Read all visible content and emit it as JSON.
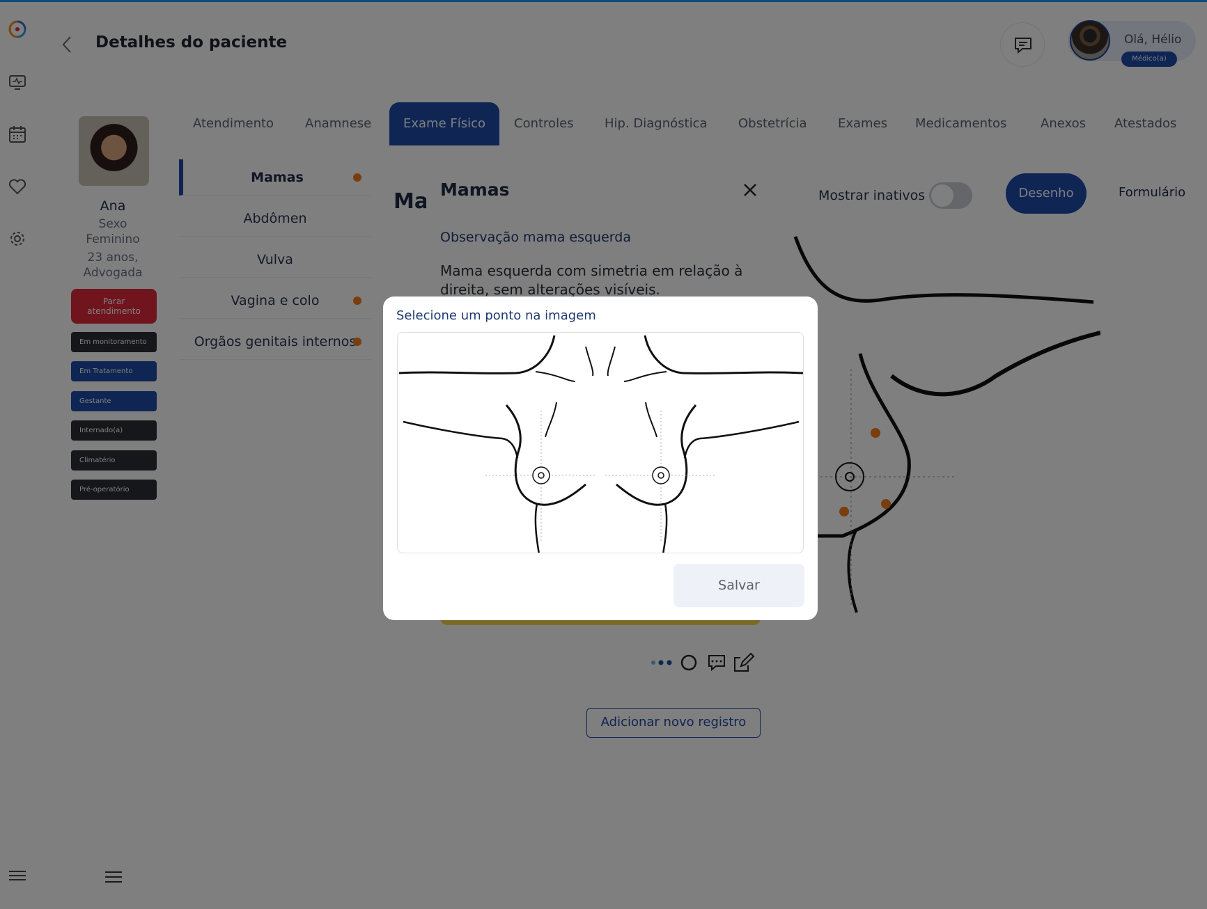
{
  "header": {
    "title": "Detalhes do paciente",
    "greeting": "Olá, Hélio",
    "role": "Médico(a)"
  },
  "patient": {
    "name": "Ana",
    "sex_line1": "Sexo",
    "sex_line2": "Feminino",
    "age_line1": "23 anos,",
    "age_line2": "Advogada",
    "stop_line1": "Parar",
    "stop_line2": "atendimento",
    "tags": [
      "Em monitoramento",
      "Em Tratamento",
      "Gestante",
      "Internado(a)",
      "Climatério",
      "Pré-operatório"
    ]
  },
  "tabs": [
    "Atendimento",
    "Anamnese",
    "Exame Físico",
    "Controles",
    "Hip. Diagnóstica",
    "Obstetrícia",
    "Exames",
    "Medicamentos",
    "Anexos",
    "Atestados"
  ],
  "sections": [
    "Mamas",
    "Abdômen",
    "Vulva",
    "Vagina e colo",
    "Orgãos genitais internos"
  ],
  "content": {
    "title": "Mamas",
    "show_inactive": "Mostrar inativos",
    "mode_drawing": "Desenho",
    "mode_form": "Formulário"
  },
  "mamas_modal": {
    "title": "Mamas",
    "obs_label": "Observação mama esquerda",
    "obs_text": "Mama esquerda com simetria em relação à direita, sem alterações visíveis.",
    "add_button": "Adicionar novo registro"
  },
  "select_dialog": {
    "title": "Selecione um ponto na imagem",
    "save_button": "Salvar"
  },
  "colors": {
    "primary": "#1f4aa8",
    "danger": "#e02b3d",
    "marker": "#f07c1a",
    "top_line": "#2196f3"
  }
}
